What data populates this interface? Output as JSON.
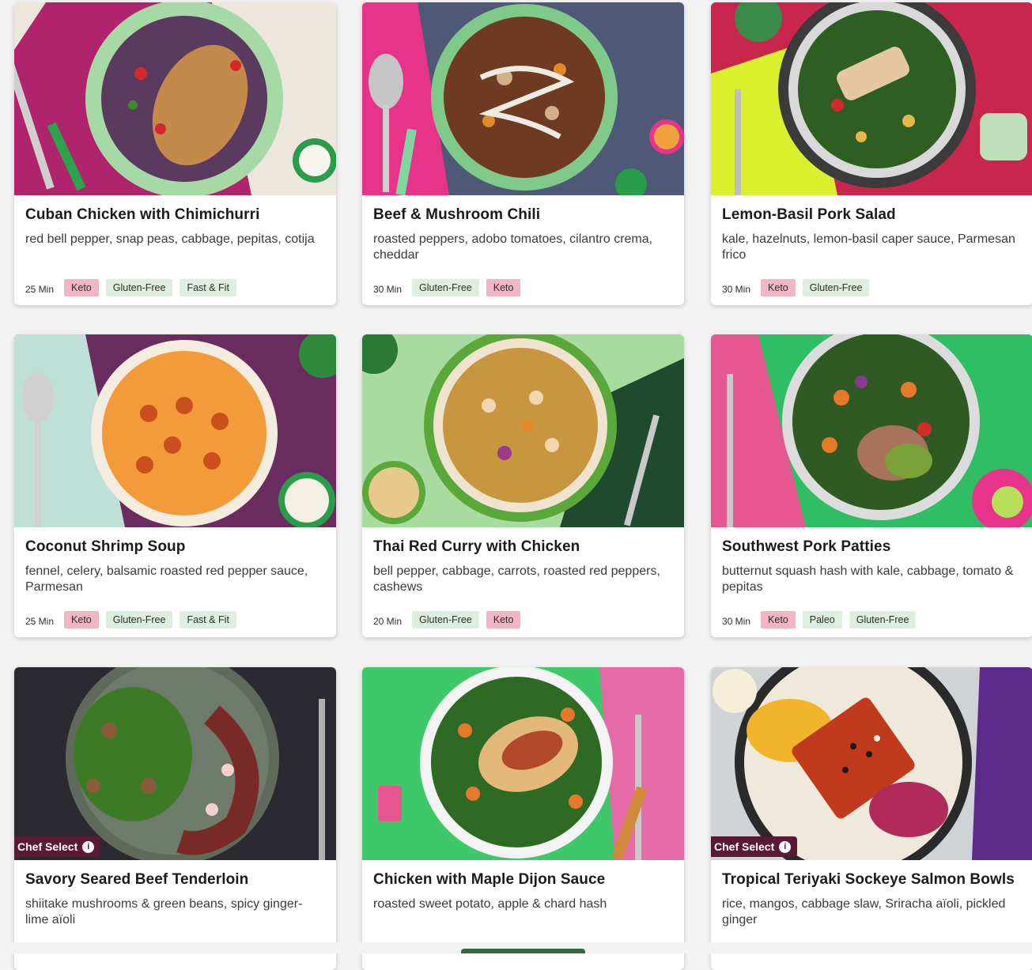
{
  "cards": [
    {
      "title": "Cuban Chicken with Chimichurri",
      "desc": "red bell pepper, snap peas, cabbage, pepitas, cotija",
      "time": "25 Min",
      "tags": [
        "Keto",
        "Gluten-Free",
        "Fast & Fit"
      ],
      "chef_select": ""
    },
    {
      "title": "Beef & Mushroom Chili",
      "desc": "roasted peppers, adobo tomatoes, cilantro crema, cheddar",
      "time": "30 Min",
      "tags": [
        "Gluten-Free",
        "Keto"
      ],
      "chef_select": ""
    },
    {
      "title": "Lemon-Basil Pork Salad",
      "desc": "kale, hazelnuts, lemon-basil caper sauce, Parmesan frico",
      "time": "30 Min",
      "tags": [
        "Keto",
        "Gluten-Free"
      ],
      "chef_select": ""
    },
    {
      "title": "Coconut Shrimp Soup",
      "desc": "fennel, celery, balsamic roasted red pepper sauce, Parmesan",
      "time": "25 Min",
      "tags": [
        "Keto",
        "Gluten-Free",
        "Fast & Fit"
      ],
      "chef_select": ""
    },
    {
      "title": "Thai Red Curry with Chicken",
      "desc": "bell pepper, cabbage, carrots, roasted red peppers, cashews",
      "time": "20 Min",
      "tags": [
        "Gluten-Free",
        "Keto"
      ],
      "chef_select": ""
    },
    {
      "title": "Southwest Pork Patties",
      "desc": "butternut squash hash with kale, cabbage, tomato & pepitas",
      "time": "30 Min",
      "tags": [
        "Keto",
        "Paleo",
        "Gluten-Free"
      ],
      "chef_select": ""
    },
    {
      "title": "Savory Seared Beef Tenderloin",
      "desc": "shiitake mushrooms & green beans, spicy ginger-lime aïoli",
      "time": "",
      "tags": [],
      "chef_select": "Chef Select"
    },
    {
      "title": "Chicken with Maple Dijon Sauce",
      "desc": "roasted sweet potato, apple & chard hash",
      "time": "",
      "tags": [],
      "chef_select": ""
    },
    {
      "title": "Tropical Teriyaki Sockeye Salmon Bowls",
      "desc": "rice, mangos, cabbage slaw, Sriracha aïoli, pickled ginger",
      "time": "",
      "tags": [],
      "chef_select": "Chef Select"
    }
  ],
  "info_icon_glyph": "i",
  "colors": {
    "keto_tag": "#f0b6c6",
    "diet_tag": "#dfeee0",
    "chef_badge": "#5a1a35",
    "accent_green": "#2d6b3a"
  }
}
